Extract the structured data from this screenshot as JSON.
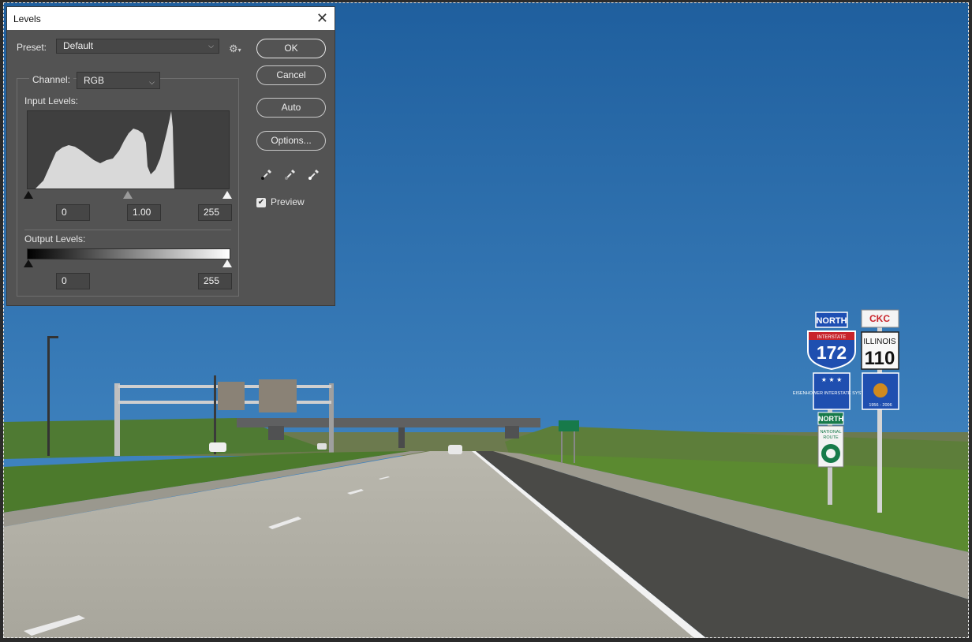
{
  "dialog": {
    "title": "Levels",
    "close_glyph": "✕",
    "preset_label": "Preset:",
    "preset_value": "Default",
    "channel_label": "Channel:",
    "channel_value": "RGB",
    "input_levels_label": "Input Levels:",
    "input_black": "0",
    "input_gamma": "1.00",
    "input_white": "255",
    "output_levels_label": "Output Levels:",
    "output_black": "0",
    "output_white": "255",
    "buttons": {
      "ok": "OK",
      "cancel": "Cancel",
      "auto": "Auto",
      "options": "Options..."
    },
    "preview_label": "Preview",
    "preview_checked": true,
    "icons": {
      "settings": "gear-icon",
      "black_point": "eyedropper-black-icon",
      "gray_point": "eyedropper-gray-icon",
      "white_point": "eyedropper-white-icon"
    }
  },
  "image_signs": {
    "north_1": "NORTH",
    "interstate": "INTERSTATE",
    "interstate_number": "172",
    "ckc": "CKC",
    "state": "ILLINOIS",
    "state_number": "110",
    "eisenhower": "EISENHOWER INTERSTATE SYSTEM",
    "north_2": "NORTH",
    "national": "NATIONAL",
    "route": "ROUTE",
    "years": "1956 - 2006"
  },
  "colors": {
    "dialog_bg": "#535353",
    "sky_top": "#1f5f9e",
    "sky_bottom": "#3b82c0",
    "interstate_blue": "#1f4fb0",
    "interstate_red": "#c8242b"
  }
}
